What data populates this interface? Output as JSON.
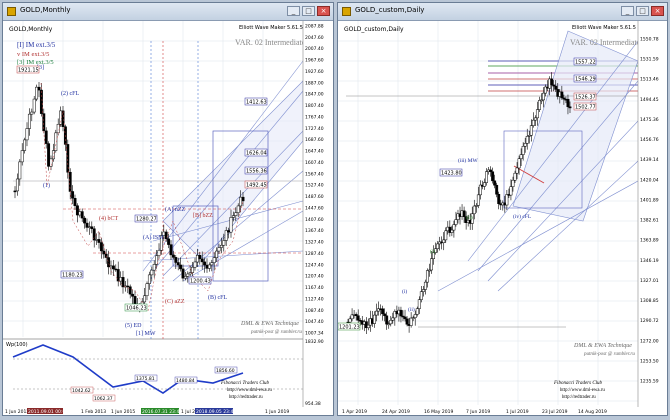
{
  "left": {
    "window_title": "GOLD,Monthly",
    "symbol_label": "GOLD,Monthly",
    "indicator": "Elliott Wave Maker 5.61.5",
    "variant": "VAR. 02 Intermediate",
    "legend": [
      "[I] IM ext.3/5",
      "v IM ext.3/5",
      "[3] IM ext.3/5"
    ],
    "wave_labels": [
      "[3]",
      "(2) cFL",
      "(1)",
      "(4) bCT",
      "(A) ISM",
      "(A) nZZ",
      "[B] bZZ",
      "(C) aZZ",
      "(B) cFL",
      "(5) ED",
      "[1] MW",
      "(4)",
      "(3)",
      "(B)",
      "(D)",
      "(A)",
      "(5)",
      "(E)"
    ],
    "price_ticks": [
      "1907.88",
      "1887.00",
      "1867.40",
      "1847.00",
      "1827.40",
      "1807.40",
      "1787.40",
      "1767.40",
      "1747.40",
      "1727.40",
      "1707.40",
      "1687.40",
      "1667.40",
      "1647.40",
      "1627.40",
      "1607.40",
      "1587.40",
      "1567.40",
      "1547.40",
      "1527.40",
      "1507.40",
      "1487.40",
      "1467.40",
      "1447.40",
      "1427.40",
      "1407.40",
      "1387.40"
    ],
    "price_ticks_visible": [
      "1907.88",
      "1887.00",
      "1867.40",
      "1847.70",
      "1827.40",
      "1807.40",
      "1787.40",
      "1767.40",
      "1747.40",
      "1727.40",
      "1707.40",
      "1687.40",
      "1667.40",
      "1647.40",
      "1627.40",
      "1607.40",
      "1587.40",
      "1567.40",
      "1547.40",
      "1527.40",
      "1507.40",
      "1487.40",
      "1467.40",
      "1447.40",
      "1427.40",
      "1407.40",
      "1387.40",
      "1367.40",
      "1347.40",
      "1327.40",
      "1307.40",
      "1287.40"
    ],
    "axis_labels": [
      "2087.88",
      "2047.60",
      "2007.40",
      "1967.60",
      "1927.60",
      "1887.00",
      "1847.00",
      "1807.40",
      "1767.40",
      "1727.40",
      "1687.60",
      "1647.40",
      "1607.40",
      "1567.40",
      "1527.40",
      "1487.60",
      "1447.60",
      "1407.60",
      "1367.40",
      "1327.40",
      "1287.40",
      "1247.40",
      "1207.40",
      "1167.40",
      "1127.40",
      "1087.40",
      "1047.40",
      "1007.34"
    ],
    "price_boxes": [
      "1921.15",
      "1180.23",
      "1375.84",
      "1280.27",
      "1163.17",
      "1200.43",
      "1046.23",
      "1626.04",
      "1556.36",
      "1492.45",
      "1412.63"
    ],
    "footer_brand": "DML & EWA Technique",
    "footer_site": "putnik-post @ rambler.ru",
    "club": "Fibonacci Traders Club",
    "club_sites": [
      "http://www.dml-ewa.ru",
      "http://redtrader.ru"
    ],
    "sub_label": "Wp(100)",
    "sub_ticks": [
      "1832.90",
      "954.38"
    ],
    "date_labels": [
      "1 Jun 2012",
      "2011.09.01 00:00",
      "1 Feb 2013",
      "1 Jun 2015",
      "2016.07.31 23:45",
      "1 Jul 2018",
      "2018.09.05 23:45",
      "1 Jun 2019"
    ],
    "info_boxes": [
      "1375.81",
      "1480.84",
      "1856.60",
      "1042.62",
      "1062.37"
    ]
  },
  "right": {
    "window_title": "GOLD_custom,Daily",
    "symbol_label": "GOLD_custom,Daily",
    "indicator": "Elliott Wave Maker 5.61.5",
    "variant": "VAR. 02 Intermediate",
    "price_ticks": [
      "1550.78",
      "1531.59",
      "1513.46",
      "1494.45",
      "1475.36",
      "1456.76",
      "1439.14",
      "1420.04",
      "1401.89",
      "1382.61",
      "1363.89",
      "1346.19",
      "1327.01",
      "1308.85",
      "1290.72",
      "1272.00"
    ],
    "price_boxes": [
      "1557.22",
      "1555.58",
      "1546.29",
      "1526.37",
      "1526.72",
      "1502.77",
      "1423.80",
      "1201.23"
    ],
    "wave_labels": [
      "(iii) MW",
      "(ii)",
      "(i)",
      "(iv) cFL",
      "(iii)",
      "(v)",
      "[iii]",
      "[iv]",
      "(i)",
      "(ii)",
      "(iii)"
    ],
    "footer_brand": "DML & EWA Technique",
    "footer_site": "putnik-post @ rambler.ru",
    "club": "Fibonacci Traders Club",
    "club_sites": [
      "http://www.dml-ewa.ru",
      "http://redtrader.ru"
    ],
    "date_labels": [
      "1 Apr 2019",
      "24 Apr 2019",
      "16 May 2019",
      "7 Jun 2019",
      "1 Jul 2019",
      "23 Jul 2019",
      "14 Aug 2019"
    ]
  },
  "chart_data": [
    {
      "type": "candlestick",
      "title": "GOLD,Monthly",
      "x": [
        "Jun 2012",
        "Feb 2013",
        "Jun 2015",
        "Jul 2018",
        "Jun 2019"
      ],
      "y_range": [
        954.38,
        2087.88
      ],
      "close_last": 1526.72,
      "trend_channel": "upward",
      "notable_prices": [
        1921.15,
        1180.23,
        1046.23,
        1375.84,
        1556.36
      ]
    },
    {
      "type": "candlestick",
      "title": "GOLD_custom,Daily",
      "x": [
        "1 Apr 2019",
        "24 Apr 2019",
        "16 May 2019",
        "7 Jun 2019",
        "1 Jul 2019",
        "23 Jul 2019",
        "14 Aug 2019"
      ],
      "y_range": [
        1272.0,
        1562.0
      ],
      "close_last": 1526.72,
      "trend_channel": "upward",
      "notable_prices": [
        1557.22,
        1546.29,
        1526.37,
        1423.8,
        1281.23
      ]
    }
  ]
}
